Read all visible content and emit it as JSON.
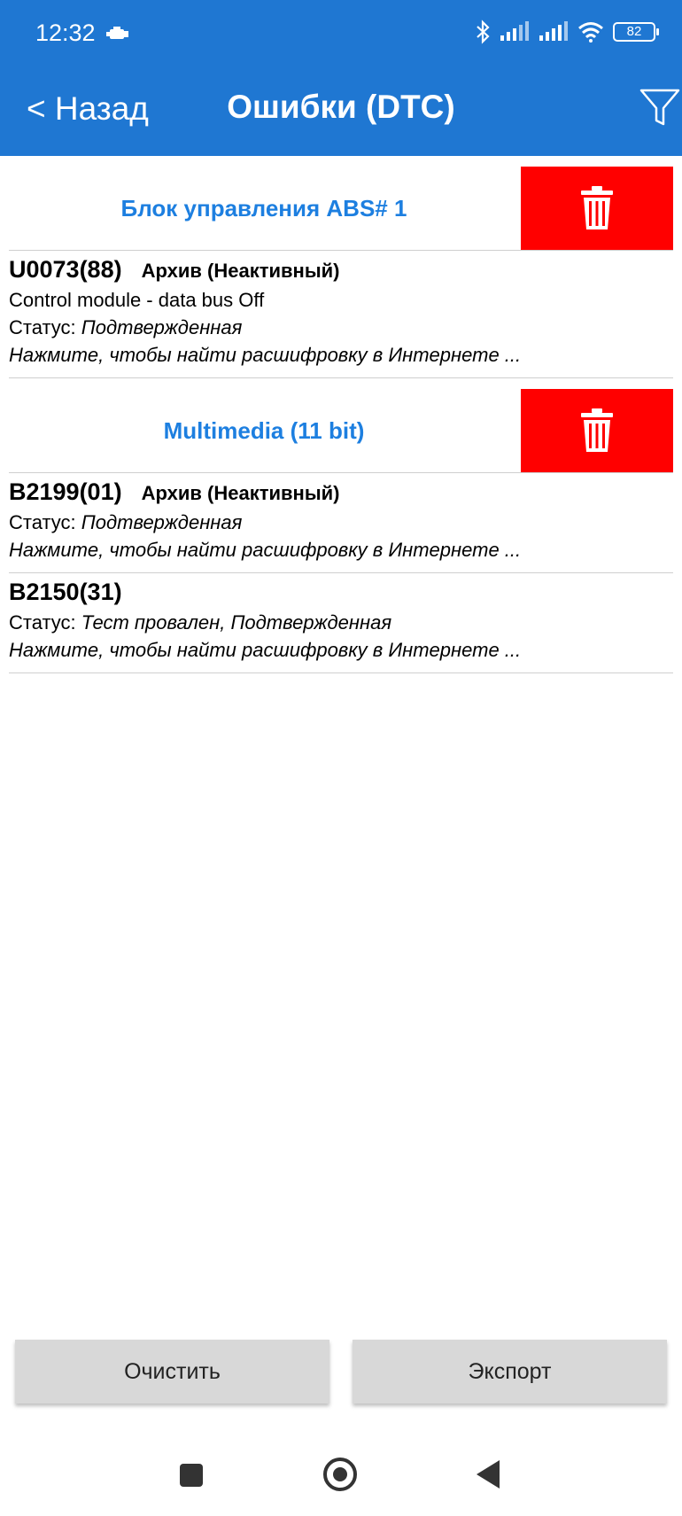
{
  "status_bar": {
    "time": "12:32",
    "battery": "82"
  },
  "header": {
    "back_label": "< Назад",
    "title": "Ошибки (DTC)"
  },
  "groups": [
    {
      "title": "Блок управления ABS# 1",
      "dtcs": [
        {
          "code": "U0073(88)",
          "archive": "Архив (Неактивный)",
          "description": "Control module - data bus Off",
          "status_label": "Статус: ",
          "status_value": "Подтвержденная",
          "hint": "Нажмите, чтобы найти расшифровку в Интернете ..."
        }
      ]
    },
    {
      "title": "Multimedia (11 bit)",
      "dtcs": [
        {
          "code": "B2199(01)",
          "archive": "Архив (Неактивный)",
          "status_label": "Статус: ",
          "status_value": "Подтвержденная",
          "hint": "Нажмите, чтобы найти расшифровку в Интернете ..."
        },
        {
          "code": "B2150(31)",
          "status_label": "Статус: ",
          "status_value": "Тест провален, Подтвержденная",
          "hint": "Нажмите, чтобы найти расшифровку в Интернете ..."
        }
      ]
    }
  ],
  "buttons": {
    "clear": "Очистить",
    "export": "Экспорт"
  },
  "colors": {
    "header_bg": "#1f77d2",
    "group_title": "#1d7fe0",
    "delete_bg": "#ff0000"
  },
  "icons": [
    "car-engine-icon",
    "bluetooth-icon",
    "signal-icon",
    "wifi-icon",
    "battery-icon",
    "filter-icon",
    "trash-icon",
    "nav-recents-icon",
    "nav-home-icon",
    "nav-back-icon"
  ]
}
